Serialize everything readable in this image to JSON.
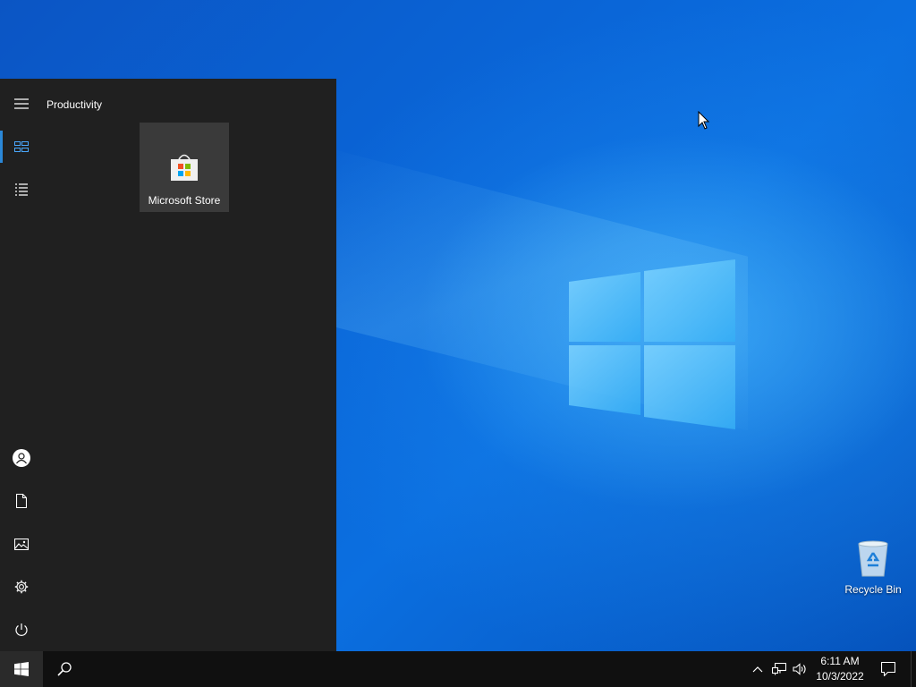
{
  "start_menu": {
    "group_title": "Productivity",
    "tiles": [
      {
        "label": "Microsoft Store",
        "icon": "microsoft-store-icon"
      }
    ],
    "rail_top": [
      {
        "name": "hamburger-menu-icon"
      },
      {
        "name": "pinned-tiles-icon",
        "active": true
      },
      {
        "name": "all-apps-list-icon"
      }
    ],
    "rail_bottom": [
      {
        "name": "user-account-icon"
      },
      {
        "name": "documents-icon"
      },
      {
        "name": "pictures-icon"
      },
      {
        "name": "settings-gear-icon"
      },
      {
        "name": "power-icon"
      }
    ]
  },
  "desktop": {
    "icons": [
      {
        "label": "Recycle Bin",
        "icon": "recycle-bin-icon"
      }
    ]
  },
  "taskbar": {
    "time": "6:11 AM",
    "date": "10/3/2022",
    "accent_color": "#2b88d8",
    "tray_icons": [
      "chevron-up-icon",
      "network-icon",
      "volume-icon"
    ]
  }
}
